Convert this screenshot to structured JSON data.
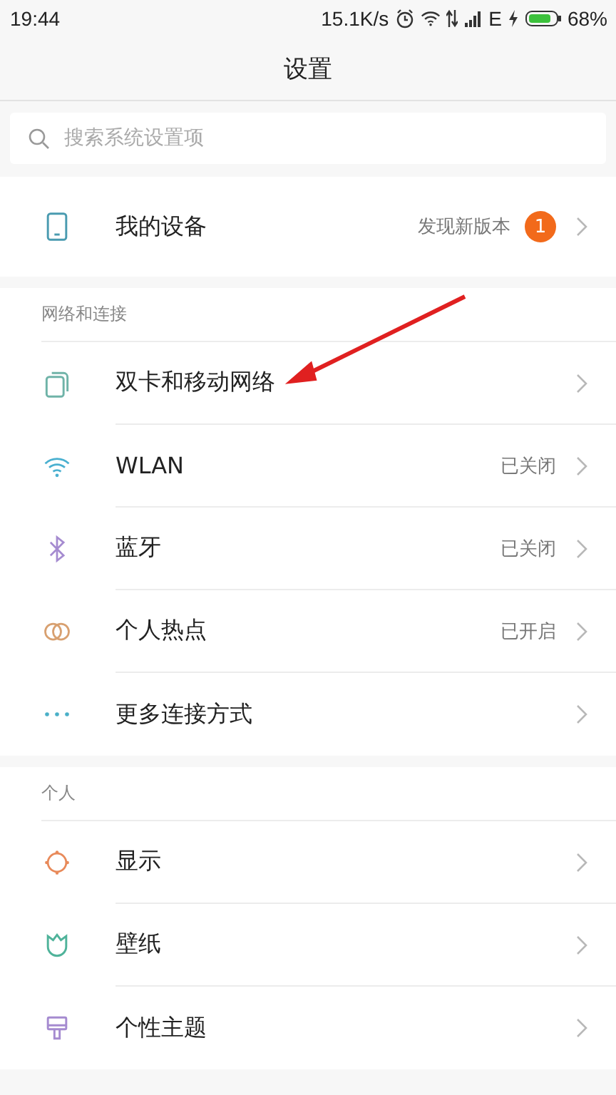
{
  "status_bar": {
    "time": "19:44",
    "speed": "15.1K/s",
    "network_type": "E",
    "battery": "68%",
    "charging": true
  },
  "title": "设置",
  "search": {
    "placeholder": "搜索系统设置项"
  },
  "device": {
    "kind": "device",
    "label": "我的设备",
    "status": "发现新版本",
    "badge": "1"
  },
  "sections": [
    {
      "header": "网络和连接",
      "items": [
        {
          "kind": "sim",
          "label": "双卡和移动网络"
        },
        {
          "kind": "wifi",
          "label": "WLAN",
          "status": "已关闭"
        },
        {
          "kind": "bluetooth",
          "label": "蓝牙",
          "status": "已关闭"
        },
        {
          "kind": "hotspot",
          "label": "个人热点",
          "status": "已开启"
        },
        {
          "kind": "more",
          "label": "更多连接方式"
        }
      ]
    },
    {
      "header": "个人",
      "items": [
        {
          "kind": "display",
          "label": "显示"
        },
        {
          "kind": "wallpaper",
          "label": "壁纸"
        },
        {
          "kind": "theme",
          "label": "个性主题"
        }
      ]
    }
  ],
  "annotation": {
    "kind": "arrow"
  }
}
